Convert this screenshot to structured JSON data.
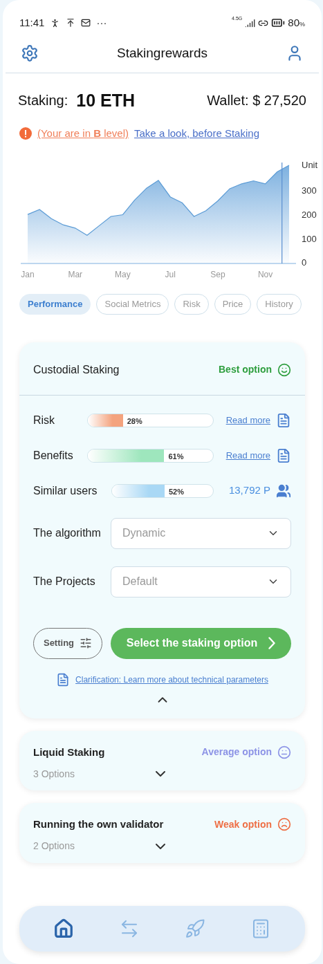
{
  "status_bar": {
    "time": "11:41",
    "more": "···",
    "network": "4.5G",
    "battery": "80",
    "battery_unit": "%"
  },
  "header": {
    "title": "Stakingrewards"
  },
  "summary": {
    "staking_label": "Staking:",
    "staking_value": "10 ETH",
    "wallet": "Wallet: $ 27,520"
  },
  "notice": {
    "level_text": "(Your are in **B** level)",
    "link": "Take a look, before Staking"
  },
  "chart_data": {
    "type": "area",
    "ylabel": "Unit",
    "categories": [
      "Jan",
      null,
      null,
      null,
      "Mar",
      null,
      null,
      null,
      "May",
      null,
      null,
      null,
      "Jul",
      null,
      null,
      null,
      "Sep",
      null,
      null,
      null,
      "Nov",
      null,
      null
    ],
    "series": [
      {
        "color": "#6fa8dc",
        "values": [
          198,
          218,
          181,
          156,
          143,
          114,
          152,
          190,
          197,
          256,
          304,
          336,
          269,
          245,
          190,
          213,
          253,
          302,
          322,
          334,
          322,
          370,
          397
        ]
      }
    ],
    "ylim": [
      0,
      408
    ],
    "yticks": [
      0,
      100,
      200,
      300
    ]
  },
  "tabs": [
    {
      "label": "Performance",
      "selected": true
    },
    {
      "label": "Social Metrics",
      "selected": false
    },
    {
      "label": "Risk",
      "selected": false
    },
    {
      "label": "Price",
      "selected": false
    },
    {
      "label": "History",
      "selected": false
    }
  ],
  "options": [
    {
      "title": "Custodial Staking",
      "rating": "Best option",
      "kind": "best",
      "expanded": true,
      "metrics": [
        {
          "label": "Risk",
          "level": 0.28,
          "reading": "28%",
          "color": "#f4a37e",
          "kind": "link",
          "side": "Read more"
        },
        {
          "label": "Benefits",
          "level": 0.61,
          "reading": "61%",
          "color": "#9ee6bd",
          "kind": "link",
          "side": "Read more"
        },
        {
          "label": "Similar users",
          "level": 0.52,
          "reading": "52%",
          "color": "#a9d8f5",
          "kind": "count",
          "side": "13,792 P"
        }
      ],
      "selects": [
        {
          "label": "The algorithm",
          "value": "Dynamic"
        },
        {
          "label": "The Projects",
          "value": "Default"
        }
      ],
      "setting": "Setting",
      "action": "Select the staking option",
      "clarification": "Clarification: Learn more about technical parameters"
    },
    {
      "title": "Liquid Staking",
      "rating": "Average option",
      "kind": "average",
      "expanded": false,
      "count": "3 Options"
    },
    {
      "title": "Running the own validator",
      "rating": "Weak option",
      "kind": "weak",
      "expanded": false,
      "count": "2 Options"
    }
  ],
  "nav": [
    {
      "kind": "home",
      "selected": true
    },
    {
      "kind": "transfer",
      "selected": false
    },
    {
      "kind": "launch",
      "selected": false
    },
    {
      "kind": "calculator",
      "selected": false
    }
  ]
}
